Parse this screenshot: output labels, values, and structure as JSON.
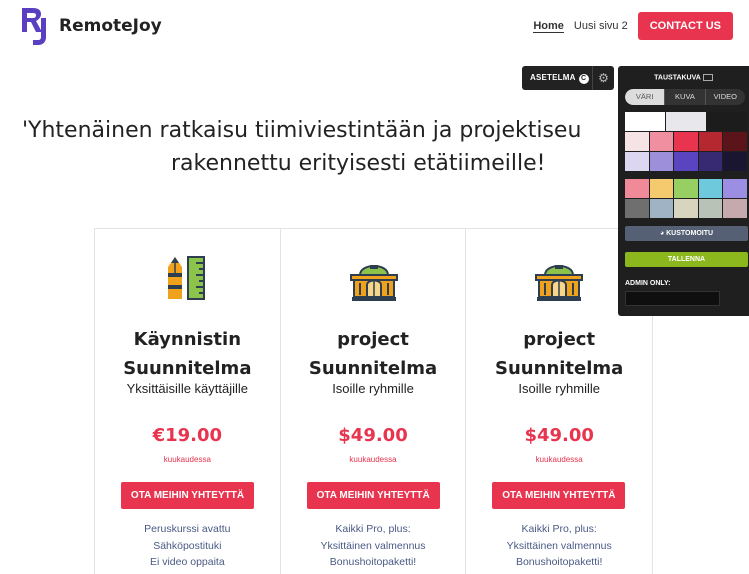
{
  "header": {
    "brand": "RemoteJoy",
    "nav": [
      {
        "label": "Home",
        "active": true
      },
      {
        "label": "Uusi sivu 2",
        "active": false
      }
    ],
    "contact_label": "CONTACT US"
  },
  "toolbar": {
    "layout_label": "ASETELMA",
    "badge": "C"
  },
  "hero": {
    "line1": "'Yhtenäinen ratkaisu tiimiviestintään ja projektiseu",
    "line2": "rakennettu erityisesti etätiimeille!"
  },
  "cards": [
    {
      "icon": "pencil-ruler-icon",
      "title1": "Käynnistin",
      "title2": "Suunnitelma",
      "subtitle": "Yksittäisille käyttäjille",
      "price": "€19.00",
      "period": "kuukaudessa",
      "button": "OTA MEIHIN YHTEYTTÄ",
      "features": [
        "Peruskurssi avattu",
        "Sähköpostituki",
        "Ei video oppaita"
      ]
    },
    {
      "icon": "building-icon",
      "title1": "project",
      "title2": "Suunnitelma",
      "subtitle": "Isoille ryhmille",
      "price": "$49.00",
      "period": "kuukaudessa",
      "button": "OTA MEIHIN YHTEYTTÄ",
      "features": [
        "Kaikki Pro, plus:",
        "Yksittäinen valmennus",
        "Bonushoitopaketti!"
      ]
    },
    {
      "icon": "building-icon",
      "title1": "project",
      "title2": "Suunnitelma",
      "subtitle": "Isoille ryhmille",
      "price": "$49.00",
      "period": "kuukaudessa",
      "button": "OTA MEIHIN YHTEYTTÄ",
      "features": [
        "Kaikki Pro, plus:",
        "Yksittäinen valmennus",
        "Bonushoitopaketti!"
      ]
    }
  ],
  "background_panel": {
    "title": "TAUSTAKUVA",
    "tabs": [
      "VÄRI",
      "KUVA",
      "VIDEO"
    ],
    "active_tab": "VÄRI",
    "swatch_rows": [
      [
        "#ffffff",
        "#e8e8ec",
        "#1c1c1c"
      ],
      [
        "#f6e3e6",
        "#ef8fa0",
        "#e8344e",
        "#b5282f",
        "#5b1419"
      ],
      [
        "#dcd6f0",
        "#9d8fd9",
        "#5b44c0",
        "#372a73",
        "#1a1530"
      ],
      [
        "#f08a99",
        "#f5c96e",
        "#97cf63",
        "#6ec9dc",
        "#9c8fe3"
      ],
      [
        "#6f6f6f",
        "#9fb3c4",
        "#d7d5bd",
        "#b9c2b7",
        "#c6a9ad"
      ]
    ],
    "customize_label": "KUSTOMOITU",
    "save_label": "TALLENNA",
    "admin_label": "ADMIN ONLY:",
    "admin_value": ""
  },
  "colors": {
    "accent": "#e8344e",
    "brand_purple": "#5a3fc0",
    "feature_text": "#4a5a84"
  }
}
